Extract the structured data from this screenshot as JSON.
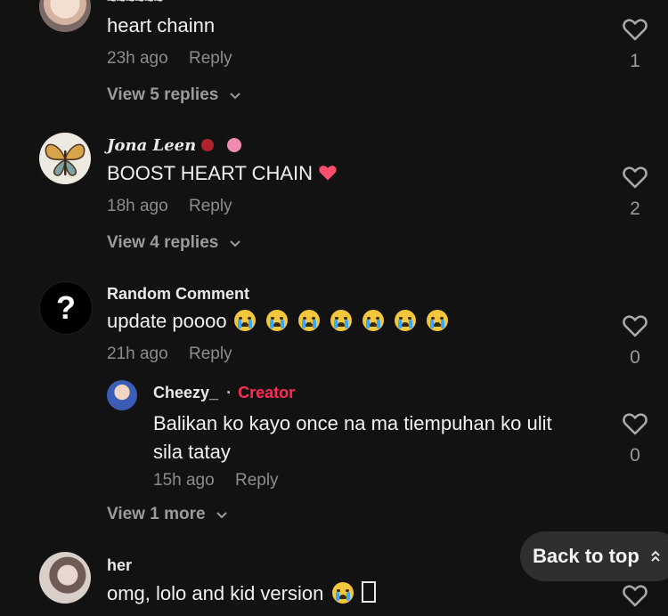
{
  "comments": [
    {
      "author": "",
      "text": "heart chainn",
      "time": "23h ago",
      "reply_label": "Reply",
      "likes": "1",
      "view_replies": "View 5 replies"
    },
    {
      "author": "Jona Leen",
      "text": "BOOST HEART CHAIN",
      "time": "18h ago",
      "reply_label": "Reply",
      "likes": "2",
      "view_replies": "View 4 replies",
      "name_emojis": [
        "rose-emoji",
        "hibiscus-emoji"
      ]
    },
    {
      "author": "Random Comment",
      "text": "update poooo",
      "time": "21h ago",
      "reply_label": "Reply",
      "likes": "0",
      "emoji_count": 7
    }
  ],
  "reply": {
    "author": "Cheezy_",
    "separator": "·",
    "badge": "Creator",
    "text_line1": "Balikan ko kayo once na ma tiempuhan ko ulit",
    "text_line2": "sila tatay",
    "time": "15h ago",
    "reply_label": "Reply",
    "likes": "0",
    "view_more": "View 1 more"
  },
  "last_comment": {
    "author": "her",
    "text": "omg, lolo and kid version",
    "trailing": "𝅆"
  },
  "back_to_top": "Back to top",
  "colors": {
    "background": "#121212",
    "creator_badge": "#fe2c55",
    "heart_emoji": "#ff4d6d"
  },
  "icons": [
    "heart-outline-icon",
    "chevron-down-icon",
    "chevron-up-icon",
    "question-mark-icon"
  ]
}
